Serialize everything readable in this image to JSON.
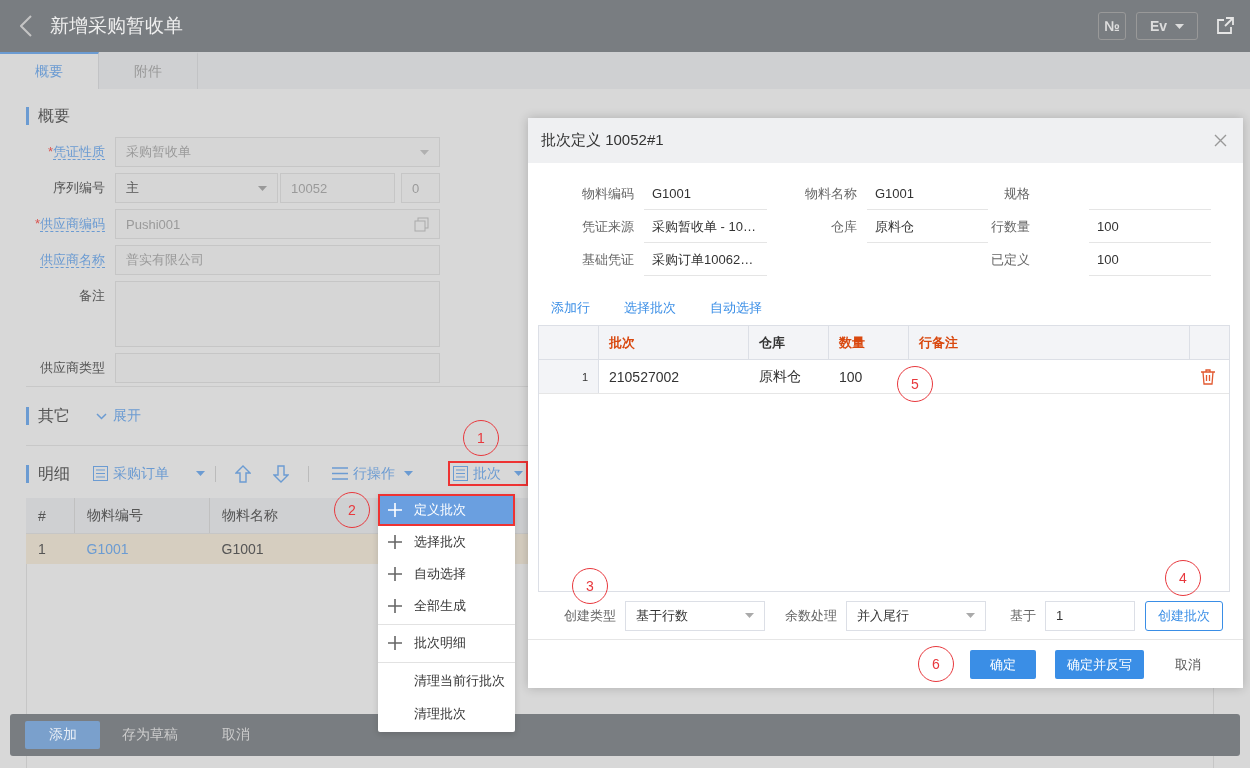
{
  "header": {
    "title": "新增采购暂收单",
    "number_button": "№",
    "language": "Ev"
  },
  "tabs": [
    {
      "label": "概要",
      "selected": true
    },
    {
      "label": "附件",
      "selected": false
    }
  ],
  "summary": {
    "title": "概要",
    "fields": [
      {
        "mark": "*",
        "label": "凭证性质",
        "link": true,
        "kind": "select",
        "value": "采购暂收单",
        "disabled": true
      },
      {
        "label": "序列编号",
        "link": false,
        "kind": "serial",
        "value": "主",
        "number": "10052",
        "suffix": "0",
        "disabled": false
      },
      {
        "mark": "*",
        "label": "供应商编码",
        "link": true,
        "kind": "lookup",
        "value": "Pushi001",
        "disabled": true
      },
      {
        "label": "供应商名称",
        "link": true,
        "kind": "text",
        "value": "普实有限公司",
        "disabled": true
      },
      {
        "label": "备注",
        "link": false,
        "kind": "textarea"
      },
      {
        "label": "供应商类型",
        "link": false,
        "kind": "text"
      }
    ]
  },
  "other": {
    "title": "其它",
    "toggle": "展开"
  },
  "detail": {
    "title": "明细",
    "toolbar": [
      {
        "kind": "order",
        "label": "采购订单",
        "boxed": false
      },
      {
        "kind": "up"
      },
      {
        "kind": "down"
      },
      {
        "kind": "rowops",
        "label": "行操作",
        "boxed": false
      },
      {
        "kind": "batch",
        "label": "批次",
        "boxed": true
      }
    ],
    "columns": [
      "#",
      "物料编号",
      "物料名称"
    ],
    "rows": [
      {
        "cells": [
          "1",
          "G1001",
          "G1001"
        ],
        "selected": true
      }
    ]
  },
  "batch_menu": [
    {
      "kind": "add",
      "label": "定义批次",
      "selected": true,
      "divider_before": false
    },
    {
      "kind": "add",
      "label": "选择批次",
      "selected": false,
      "divider_before": false
    },
    {
      "kind": "add",
      "label": "自动选择",
      "selected": false,
      "divider_before": false
    },
    {
      "kind": "add",
      "label": "全部生成",
      "selected": false,
      "divider_before": false
    },
    {
      "kind": "add",
      "label": "批次明细",
      "selected": false,
      "divider_before": true
    },
    {
      "kind": "plain",
      "label": "清理当前行批次",
      "selected": false,
      "divider_before": true
    },
    {
      "kind": "plain",
      "label": "清理批次",
      "selected": false,
      "divider_before": false
    }
  ],
  "footer": [
    {
      "label": "添加",
      "primary": true
    },
    {
      "label": "存为草稿",
      "primary": false
    },
    {
      "label": "取消",
      "primary": false
    }
  ],
  "dialog": {
    "title": "批次定义 10052#1",
    "info": [
      {
        "kind": "field",
        "label": "物料编码",
        "value": "G1001"
      },
      {
        "kind": "field",
        "label": "物料名称",
        "value": "G1001"
      },
      {
        "kind": "field",
        "label": "规格"
      },
      {
        "kind": "field",
        "label": "凭证来源",
        "value": "采购暂收单 - 10…"
      },
      {
        "kind": "field",
        "label": "仓库",
        "value": "原料仓"
      },
      {
        "kind": "field",
        "label": "行数量",
        "value": "100"
      },
      {
        "kind": "field",
        "label": "基础凭证",
        "value": "采购订单10062…"
      },
      {
        "kind": "blank"
      },
      {
        "kind": "field",
        "label": "已定义",
        "value": "100"
      }
    ],
    "actions": [
      "添加行",
      "选择批次",
      "自动选择"
    ],
    "columns": [
      {
        "label": "批次",
        "required": true
      },
      {
        "label": "仓库",
        "required": false
      },
      {
        "label": "数量",
        "required": true
      },
      {
        "label": "行备注",
        "required": true
      }
    ],
    "rows": [
      {
        "number": "1",
        "cells": [
          "210527002",
          "原料仓",
          "100"
        ]
      }
    ],
    "create": [
      {
        "kind": "select",
        "label": "创建类型",
        "value": "基于行数"
      },
      {
        "kind": "select",
        "label": "余数处理",
        "value": "并入尾行"
      },
      {
        "kind": "input",
        "label": "基于",
        "value": "1"
      }
    ],
    "create_button": "创建批次",
    "buttons": [
      {
        "label": "确定",
        "kind": "primary"
      },
      {
        "label": "确定并反写",
        "kind": "primary"
      },
      {
        "label": "取消",
        "kind": "plain"
      }
    ]
  },
  "annotations": [
    "1",
    "2",
    "3",
    "4",
    "5",
    "6"
  ]
}
